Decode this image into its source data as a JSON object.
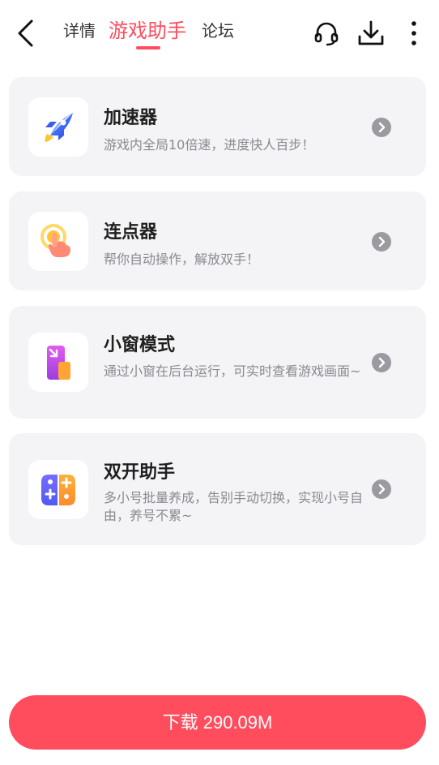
{
  "header": {
    "tabs": [
      {
        "label": "详情"
      },
      {
        "label": "游戏助手"
      },
      {
        "label": "论坛"
      }
    ],
    "active_tab": "游戏助手",
    "accent_color": "#ff4d5e"
  },
  "features": [
    {
      "title": "加速器",
      "desc": "游戏内全局10倍速，进度快人百步！",
      "icon": "rocket-icon"
    },
    {
      "title": "连点器",
      "desc": "帮你自动操作，解放双手！",
      "icon": "tap-hand-icon"
    },
    {
      "title": "小窗模式",
      "desc": "通过小窗在后台运行，可实时查看游戏画面~",
      "icon": "small-window-icon"
    },
    {
      "title": "双开助手",
      "desc": "多小号批量养成，告别手动切换，实现小号自由，养号不累~",
      "icon": "dual-gamepad-icon"
    }
  ],
  "download_button": {
    "label": "下载 290.09M"
  }
}
